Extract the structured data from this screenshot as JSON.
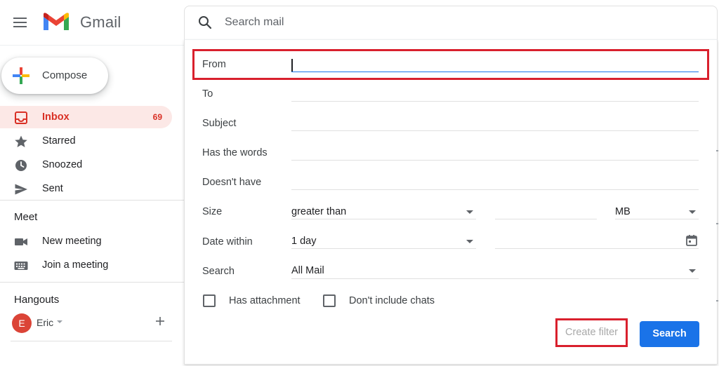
{
  "header": {
    "app_name": "Gmail",
    "search_placeholder": "Search mail"
  },
  "compose": {
    "label": "Compose"
  },
  "nav": [
    {
      "name": "inbox",
      "label": "Inbox",
      "count": "69",
      "active": true
    },
    {
      "name": "starred",
      "label": "Starred"
    },
    {
      "name": "snoozed",
      "label": "Snoozed"
    },
    {
      "name": "sent",
      "label": "Sent"
    }
  ],
  "meet": {
    "title": "Meet",
    "items": [
      {
        "label": "New meeting"
      },
      {
        "label": "Join a meeting"
      }
    ]
  },
  "hangouts": {
    "title": "Hangouts",
    "avatar_letter": "E",
    "user_name": "Eric"
  },
  "search_panel": {
    "fields": [
      {
        "label": "From",
        "value": ""
      },
      {
        "label": "To",
        "value": ""
      },
      {
        "label": "Subject",
        "value": ""
      },
      {
        "label": "Has the words",
        "value": ""
      },
      {
        "label": "Doesn't have",
        "value": ""
      }
    ],
    "size": {
      "label": "Size",
      "operator": "greater than",
      "value": "",
      "unit": "MB"
    },
    "date_within": {
      "label": "Date within",
      "value": "1 day"
    },
    "search_in": {
      "label": "Search",
      "value": "All Mail"
    },
    "checkboxes": [
      {
        "label": "Has attachment",
        "checked": false
      },
      {
        "label": "Don't include chats",
        "checked": false
      }
    ],
    "create_filter_label": "Create filter",
    "search_button_label": "Search"
  },
  "colors": {
    "accent": "#1a73e8",
    "inbox_active": "#d93025",
    "highlight": "#d9202d"
  }
}
